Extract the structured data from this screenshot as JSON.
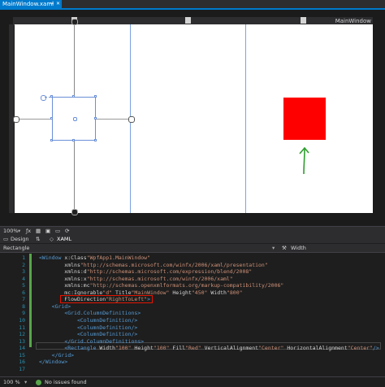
{
  "tab": {
    "title": "MainWindow.xaml",
    "pin_icon": "pin-icon",
    "close_icon": "close-icon"
  },
  "designer": {
    "window_title": "MainWindow",
    "colors": {
      "rectangle_fill": "#ff0000",
      "arrow": "#2e9e2e",
      "selection": "#6a8fd8"
    }
  },
  "zoombar": {
    "zoom": "100%",
    "items": [
      "fx-icon",
      "grid-icon",
      "snap-icon",
      "ruler-icon",
      "refresh-icon"
    ]
  },
  "view_tabs": {
    "design": "Design",
    "swap": "⇅",
    "xaml": "XAML"
  },
  "property_bar": {
    "element": "Rectangle",
    "property": "Width"
  },
  "editor": {
    "line_numbers": [
      "1",
      "2",
      "3",
      "4",
      "5",
      "6",
      "7",
      "8",
      "9",
      "10",
      "11",
      "12",
      "13",
      "14",
      "15",
      "16",
      "17"
    ],
    "lines": [
      "<Window x:Class=\"WpfApp1.MainWindow\"",
      "        xmlns=\"http://schemas.microsoft.com/winfx/2006/xaml/presentation\"",
      "        xmlns:d=\"http://schemas.microsoft.com/expression/blend/2008\"",
      "        xmlns:x=\"http://schemas.microsoft.com/winfx/2006/xaml\"",
      "        xmlns:mc=\"http://schemas.openxmlformats.org/markup-compatibility/2006\"",
      "        mc:Ignorable=\"d\" Title=\"MainWindow\" Height=\"450\" Width=\"800\"",
      "        FlowDirection=\"RightToLeft\">",
      "    <Grid>",
      "        <Grid.ColumnDefinitions>",
      "            <ColumnDefinition/>",
      "            <ColumnDefinition/>",
      "            <ColumnDefinition/>",
      "        </Grid.ColumnDefinitions>",
      "        <Rectangle Width=\"100\" Height=\"100\" Fill=\"Red\" VerticalAlignment=\"Center\" HorizontalAlignment=\"Center\"/>",
      "    </Grid>",
      "</Window>",
      ""
    ]
  },
  "status": {
    "zoom": "100 %",
    "issues": "No issues found"
  }
}
